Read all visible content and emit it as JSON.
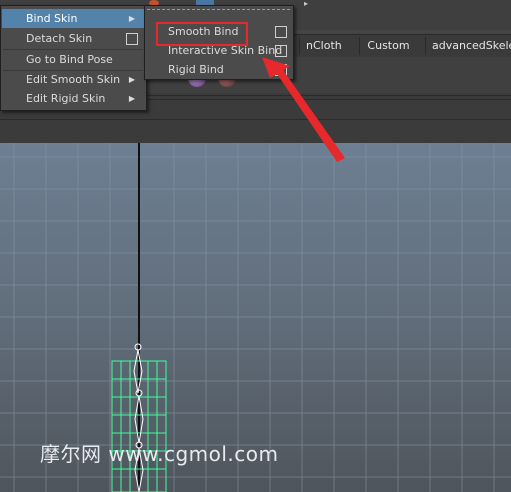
{
  "main_menu": {
    "items": [
      {
        "label": "Bind Skin",
        "has_submenu": true,
        "has_option_box": false,
        "highlighted": true
      },
      {
        "label": "Detach Skin",
        "has_submenu": false,
        "has_option_box": true,
        "highlighted": false
      },
      {
        "label": "Go to Bind Pose",
        "has_submenu": false,
        "has_option_box": false,
        "highlighted": false
      },
      {
        "label": "Edit Smooth Skin",
        "has_submenu": true,
        "has_option_box": false,
        "highlighted": false
      },
      {
        "label": "Edit Rigid Skin",
        "has_submenu": true,
        "has_option_box": false,
        "highlighted": false
      }
    ]
  },
  "submenu": {
    "items": [
      {
        "label": "Smooth Bind",
        "has_option_box": true,
        "annotated": true
      },
      {
        "label": "Interactive Skin Bind",
        "has_option_box": true,
        "annotated": false
      },
      {
        "label": "Rigid Bind",
        "has_option_box": true,
        "annotated": false
      }
    ]
  },
  "shelf_tabs": [
    "nCloth",
    "Custom",
    "advancedSkeleto"
  ],
  "watermark": "摩尔网 www.cgmol.com",
  "colors": {
    "menu_bg": "#4b4b4b",
    "highlight": "#5383ab",
    "annotation_red": "#e8292b",
    "mesh_green": "#3cff9e",
    "viewport_top": "#6d7f93"
  }
}
